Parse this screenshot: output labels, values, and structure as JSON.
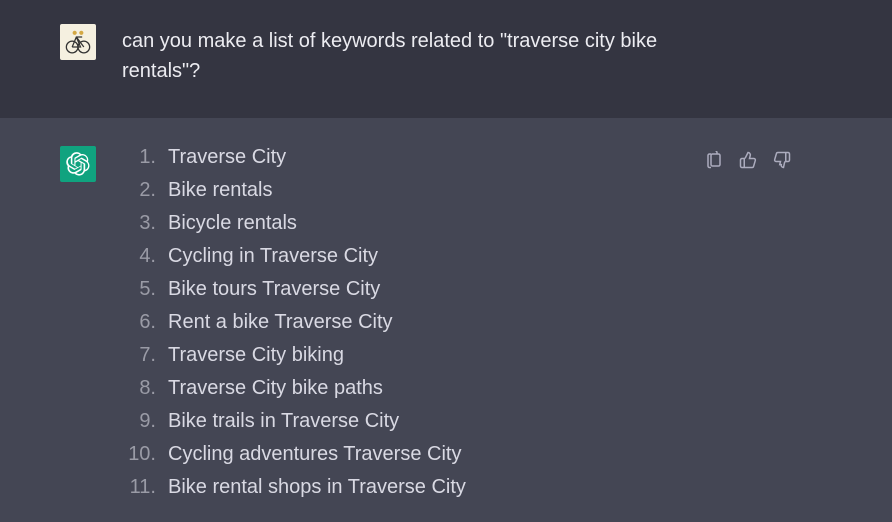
{
  "user": {
    "prompt": "can you make a list of keywords related to \"traverse city bike rentals\"?"
  },
  "assistant": {
    "items": [
      "Traverse City",
      "Bike rentals",
      "Bicycle rentals",
      "Cycling in Traverse City",
      "Bike tours Traverse City",
      "Rent a bike Traverse City",
      "Traverse City biking",
      "Traverse City bike paths",
      "Bike trails in Traverse City",
      "Cycling adventures Traverse City",
      "Bike rental shops in Traverse City"
    ]
  }
}
